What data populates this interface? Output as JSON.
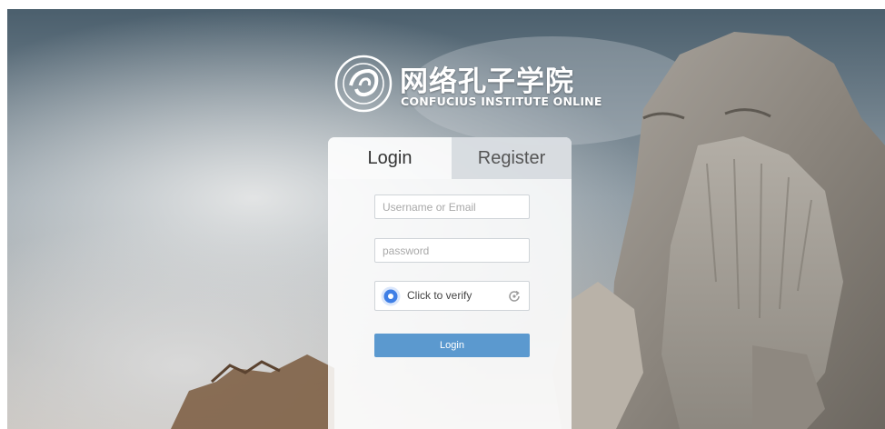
{
  "logo": {
    "title_cn": "网络孔子学院",
    "title_en": "CONFUCIUS INSTITUTE ONLINE",
    "emblem_icon": "confucius-institute-emblem-icon"
  },
  "auth": {
    "tabs": [
      {
        "label": "Login",
        "active": true
      },
      {
        "label": "Register",
        "active": false
      }
    ],
    "username_placeholder": "Username or Email",
    "password_placeholder": "password",
    "verify_label": "Click to verify",
    "verify_icon": "verify-dot-icon",
    "refresh_icon": "refresh-icon",
    "login_button": "Login"
  },
  "colors": {
    "accent": "#5b99cf",
    "verify_blue": "#3f7fe6",
    "tab_inactive": "#d6dade"
  }
}
